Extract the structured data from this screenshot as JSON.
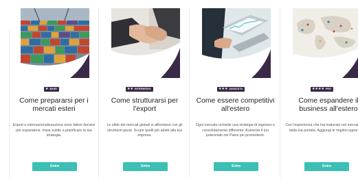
{
  "courses": [
    {
      "stars": "★",
      "level": "BASE",
      "title": "Come prepararsi per i mercati esteri",
      "description": "Export e internazionalizzazione sono fattori decisivi per espandersi. Inizia subito a pianificare la tua strategia.",
      "button_label": "Entra",
      "image_subject": "shipping-containers-port"
    },
    {
      "stars": "★★",
      "level": "INTERMEDIO",
      "title": "Come strutturarsi per l'export",
      "description": "Le sfide dei mercati globali si affrontano con gli strumenti giusti. Scopri quelli più adatti alla tua impresa.",
      "button_label": "Entra",
      "image_subject": "handshake"
    },
    {
      "stars": "★★★",
      "level": "AVANZATO",
      "title": "Come essere competitivi all'estero",
      "description": "Ogni mercato richiede una strategia di ingresso e consolidamento differente. Aumenta il tuo potenziale nei Paesi più promettenti.",
      "button_label": "Entra",
      "image_subject": "laptop-analytics"
    },
    {
      "stars": "★★★★",
      "level": "PRO",
      "title": "Come espandere il business all'estero",
      "description": "Con l'esperienza che hai maturato nel mercato è fuori dalla tua portata. Aggiungi le migliori opportunità.",
      "button_label": "Entra",
      "image_subject": "world-map-pins"
    }
  ],
  "colors": {
    "badge_bg": "#3a2947",
    "button_bg": "#3cbfb4",
    "accent_purple": "#3a2947"
  }
}
